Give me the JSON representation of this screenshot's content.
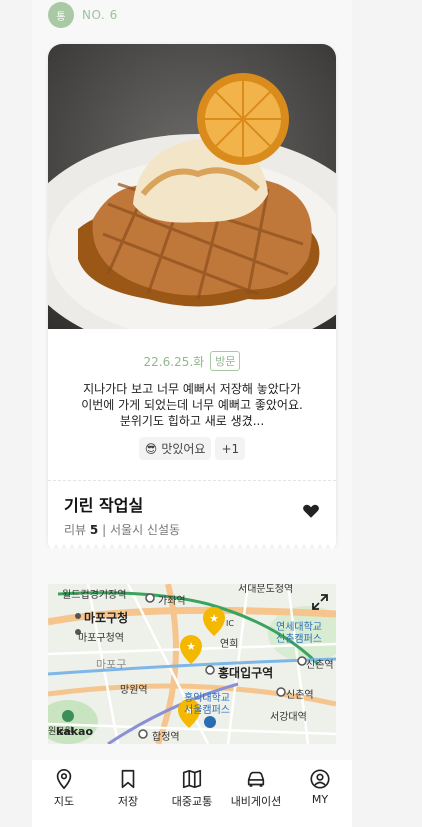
{
  "header": {
    "avatar_text": "통",
    "number_label": "NO. 6"
  },
  "card": {
    "photo_icon": "waffle-photo",
    "date": "22.6.25.화",
    "visit_badge": "방문",
    "review_text": "지나가다 보고 너무 예뻐서 저장해 놓았다가 이번에 가게 되었는데 너무 예뻐고 좋았어요. 분위기도 힙하고 새로 생겼...",
    "reaction_emoji": "😎",
    "reaction_label": "맛있어요",
    "reaction_more": "+1",
    "place_name": "기린 작업실",
    "review_label": "리뷰",
    "review_count": "5",
    "separator": "|",
    "location": "서울시 신설동",
    "heart_icon": "heart-filled-icon"
  },
  "map": {
    "labels": {
      "l1": "월드컵경기장역",
      "l2": "가좌역",
      "l3": "서대문도청역",
      "l4": "마포구청",
      "l5": "마포구청역",
      "l6": "마포구",
      "l7": "망원역",
      "l8": "홍대입구역",
      "l9": "연세대학교",
      "l10": "신촌캠퍼스",
      "l11": "신촌역",
      "l12": "신촌역",
      "l13": "홍익대학교",
      "l14": "서울캠퍼스",
      "l15": "서강대역",
      "l16": "합정역",
      "l17": "연희",
      "l18": "IC",
      "l19": "원공원"
    },
    "logo": "kakao",
    "expand_icon": "expand-icon",
    "colors": {
      "marker": "#f5b800",
      "park": "#c9e4c0",
      "road": "#ffffff",
      "arterial": "#f6c58e"
    }
  },
  "tabbar": {
    "items": [
      {
        "label": "지도",
        "icon": "map-pin-icon"
      },
      {
        "label": "저장",
        "icon": "bookmark-icon"
      },
      {
        "label": "대중교통",
        "icon": "map-fold-icon"
      },
      {
        "label": "내비게이션",
        "icon": "car-icon"
      },
      {
        "label": "MY",
        "icon": "user-circle-icon"
      }
    ]
  },
  "colors": {
    "accent_green": "#8fb98b",
    "heart": "#222222"
  }
}
